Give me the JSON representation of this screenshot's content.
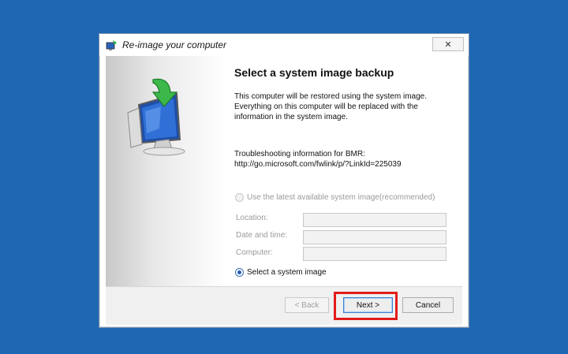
{
  "window": {
    "title": "Re-image your computer",
    "close_glyph": "✕"
  },
  "content": {
    "heading": "Select a system image backup",
    "description": "This computer will be restored using the system image. Everything on this computer will be replaced with the information in the system image.",
    "troubleshoot_label": "Troubleshooting information for BMR:",
    "troubleshoot_link": "http://go.microsoft.com/fwlink/p/?LinkId=225039",
    "option_latest": "Use the latest available system image(recommended)",
    "option_select": "Select a system image",
    "selected_option": "select",
    "fields": {
      "location_label": "Location:",
      "datetime_label": "Date and time:",
      "computer_label": "Computer:"
    }
  },
  "footer": {
    "back_label": "< Back",
    "next_label": "Next >",
    "cancel_label": "Cancel"
  },
  "colors": {
    "desktop": "#1d67b3",
    "highlight": "#e31b1b"
  }
}
